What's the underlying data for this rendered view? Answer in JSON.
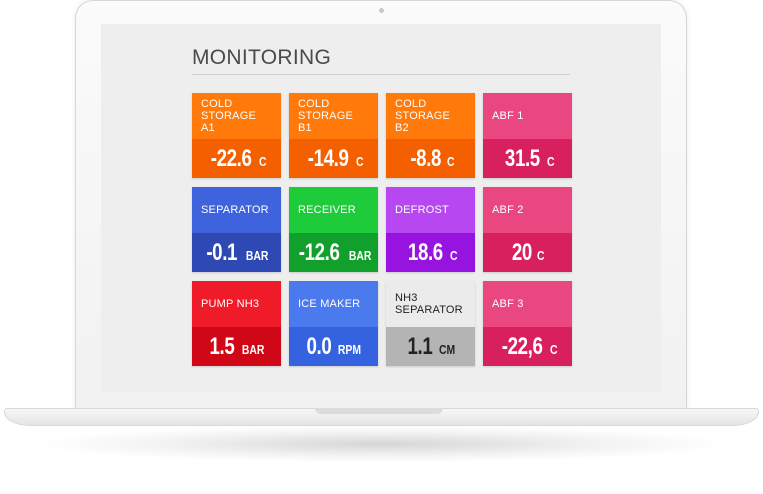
{
  "dashboard": {
    "title": "MONITORING",
    "tiles": [
      {
        "label": "COLD STORAGE A1",
        "value": "-22.6",
        "unit": "C",
        "top": "#ff7a0a",
        "bottom": "#f45f00"
      },
      {
        "label": "COLD STORAGE B1",
        "value": "-14.9",
        "unit": "C",
        "top": "#ff7a0a",
        "bottom": "#f45f00"
      },
      {
        "label": "COLD STORAGE B2",
        "value": "-8.8",
        "unit": "C",
        "top": "#ff7a0a",
        "bottom": "#f45f00"
      },
      {
        "label": "ABF 1",
        "value": "31.5",
        "unit": "C",
        "top": "#ea4680",
        "bottom": "#d9205f"
      },
      {
        "label": "SEPARATOR",
        "value": "-0.1",
        "unit": "BAR",
        "top": "#3f63dc",
        "bottom": "#2e48b4"
      },
      {
        "label": "RECEIVER",
        "value": "-12.6",
        "unit": "BAR",
        "top": "#1ecb3a",
        "bottom": "#12a02c"
      },
      {
        "label": "DEFROST",
        "value": "18.6",
        "unit": "C",
        "top": "#b747f0",
        "bottom": "#9613e0"
      },
      {
        "label": "ABF 2",
        "value": "20",
        "unit": "C",
        "top": "#ea4680",
        "bottom": "#d9205f"
      },
      {
        "label": "PUMP NH3",
        "value": "1.5",
        "unit": "BAR",
        "top": "#f01b28",
        "bottom": "#cf0716"
      },
      {
        "label": "ICE MAKER",
        "value": "0.0",
        "unit": "RPM",
        "top": "#4b79ee",
        "bottom": "#3562df"
      },
      {
        "label": "NH3 SEPARATOR",
        "value": "1.1",
        "unit": "CM",
        "top": "#ebebeb",
        "bottom": "#b4b4b4",
        "dark": true
      },
      {
        "label": "ABF 3",
        "value": "-22,6",
        "unit": "C",
        "top": "#ea4680",
        "bottom": "#d9205f"
      }
    ]
  }
}
